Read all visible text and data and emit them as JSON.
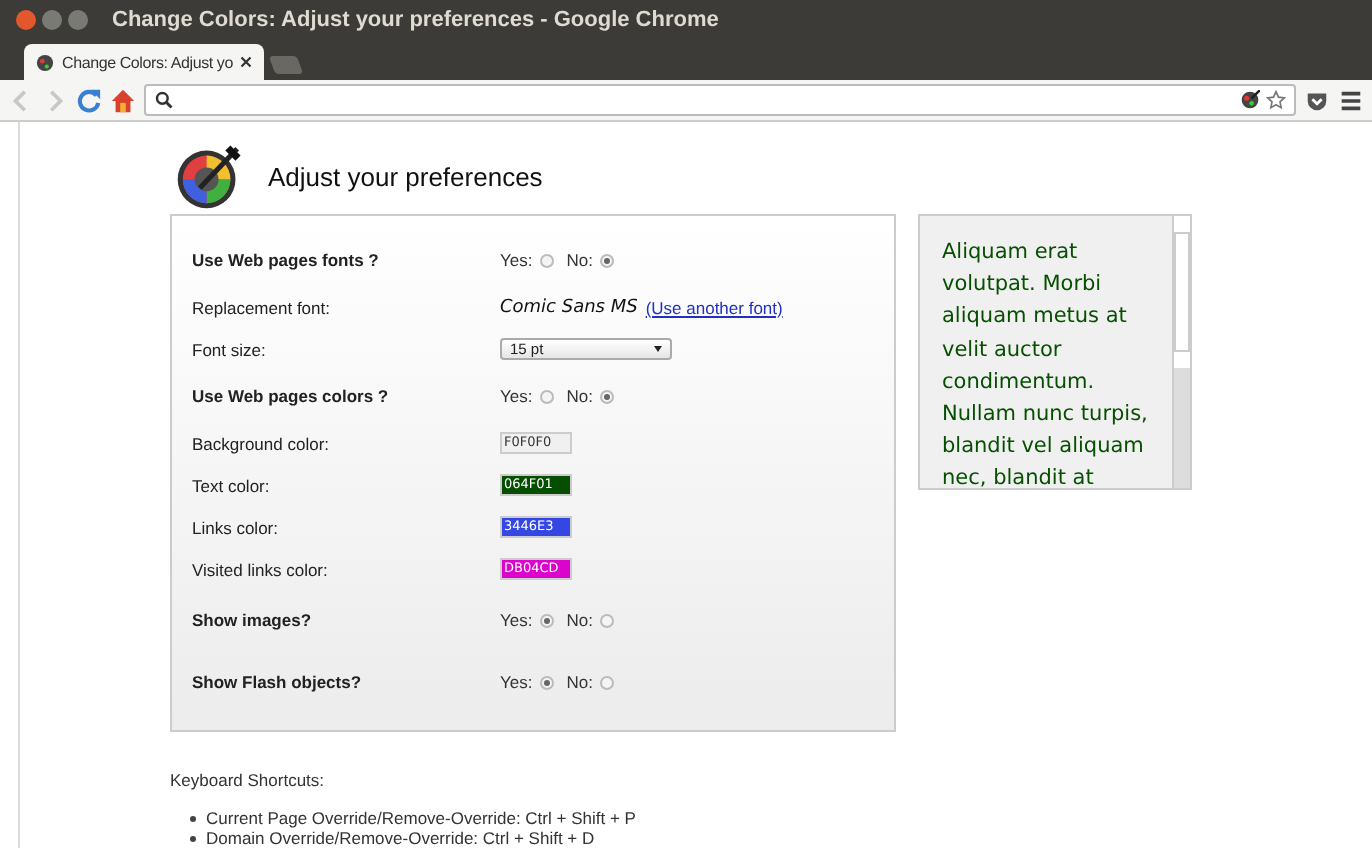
{
  "window": {
    "title": "Change Colors: Adjust your preferences - Google Chrome"
  },
  "tabs": [
    {
      "label": "Change Colors: Adjust yo",
      "selected": true
    }
  ],
  "page": {
    "heading": "Adjust your preferences",
    "settings": [
      {
        "kind": "radio",
        "label": "Use Web pages fonts ?",
        "options": [
          {
            "label": "Yes:",
            "selected": false
          },
          {
            "label": "No:",
            "selected": true
          }
        ]
      },
      {
        "kind": "font",
        "label": "Replacement font:",
        "value": "Comic Sans MS",
        "link": "(Use another font)"
      },
      {
        "kind": "select",
        "label": "Font size:",
        "value": "15 pt"
      },
      {
        "kind": "radio",
        "label": "Use Web pages colors ?",
        "options": [
          {
            "label": "Yes:",
            "selected": false
          },
          {
            "label": "No:",
            "selected": true
          }
        ]
      },
      {
        "kind": "color",
        "label": "Background color:",
        "value": "F0F0F0",
        "color": "#f0f0f0"
      },
      {
        "kind": "color",
        "label": "Text color:",
        "value": "064F01",
        "color": "#064f01"
      },
      {
        "kind": "color",
        "label": "Links color:",
        "value": "3446E3",
        "color": "#3446e3"
      },
      {
        "kind": "color",
        "label": "Visited links color:",
        "value": "DB04CD",
        "color": "#db04cd"
      },
      {
        "kind": "radio",
        "label": "Show images?",
        "options": [
          {
            "label": "Yes:",
            "selected": true
          },
          {
            "label": "No:",
            "selected": false
          }
        ]
      },
      {
        "kind": "radio",
        "label": "Show Flash objects?",
        "options": [
          {
            "label": "Yes:",
            "selected": true
          },
          {
            "label": "No:",
            "selected": false
          }
        ]
      }
    ],
    "preview": {
      "text": "Aliquam erat volutpat. Morbi aliquam metus at velit auctor condimentum. Nullam nunc turpis, blandit vel aliquam nec, blandit at"
    },
    "shortcuts": {
      "title": "Keyboard Shortcuts:",
      "items": [
        "Current Page Override/Remove-Override: Ctrl + Shift + P",
        "Domain Override/Remove-Override: Ctrl + Shift + D"
      ]
    }
  }
}
